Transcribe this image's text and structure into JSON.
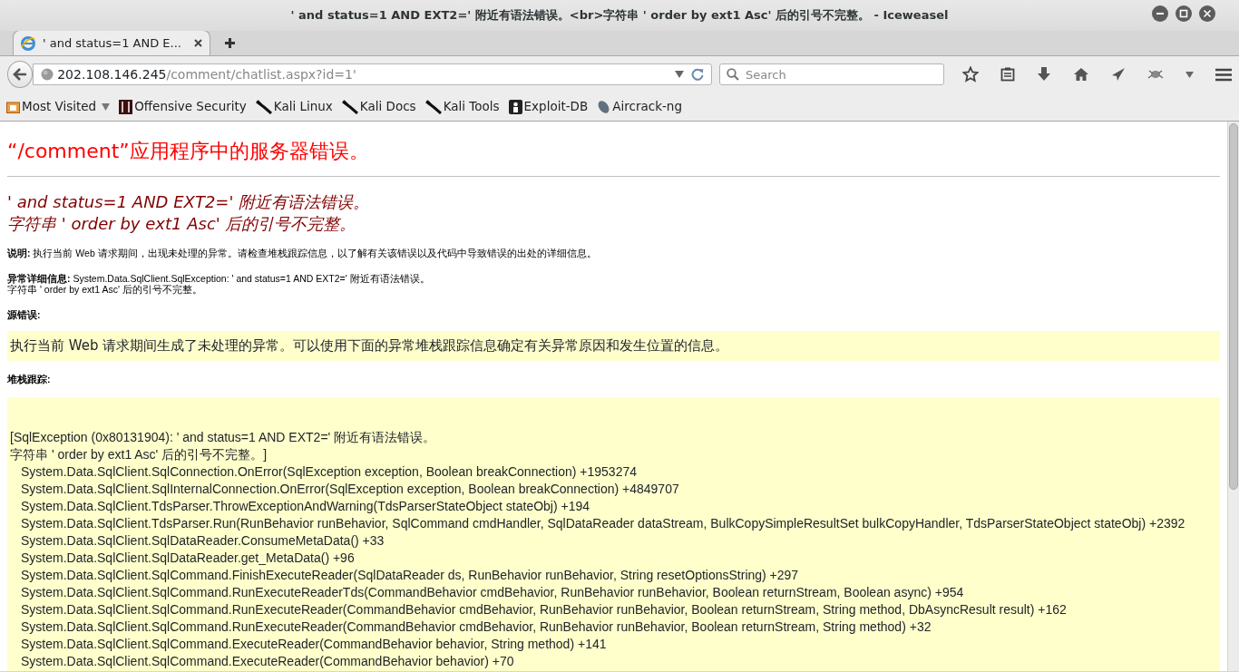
{
  "window": {
    "title": "' and status=1 AND EXT2=' 附近有语法错误。<br>字符串 ' order by ext1 Asc' 后的引号不完整。 - Iceweasel"
  },
  "tabs": [
    {
      "label": "' and status=1 AND E...",
      "selected": true
    }
  ],
  "address_bar": {
    "host": "202.108.146.245",
    "path": "/comment/chatlist.aspx?id=1'"
  },
  "search": {
    "placeholder": "Search"
  },
  "bookmarks": [
    {
      "label": "Most Visited",
      "dropdown": true
    },
    {
      "label": "Offensive Security",
      "dropdown": false
    },
    {
      "label": "Kali Linux",
      "dropdown": false
    },
    {
      "label": "Kali Docs",
      "dropdown": false
    },
    {
      "label": "Kali Tools",
      "dropdown": false
    },
    {
      "label": "Exploit-DB",
      "dropdown": false
    },
    {
      "label": "Aircrack-ng",
      "dropdown": false
    }
  ],
  "page": {
    "heading": "“/comment”应用程序中的服务器错误。",
    "error_message": [
      "' and status=1 AND EXT2=' 附近有语法错误。",
      "字符串 ' order by ext1 Asc' 后的引号不完整。"
    ],
    "description": {
      "label": "说明:",
      "text": "执行当前 Web 请求期间，出现未处理的异常。请检查堆栈跟踪信息，以了解有关该错误以及代码中导致错误的出处的详细信息。"
    },
    "exception_details": {
      "label": "异常详细信息:",
      "lines": [
        "System.Data.SqlClient.SqlException: ' and status=1 AND EXT2=' 附近有语法错误。",
        "字符串 ' order by ext1 Asc' 后的引号不完整。"
      ]
    },
    "source_error": {
      "label": "源错误:",
      "text": "执行当前 Web 请求期间生成了未处理的异常。可以使用下面的异常堆栈跟踪信息确定有关异常原因和发生位置的信息。"
    },
    "stack_trace": {
      "label": "堆栈跟踪:",
      "lines": [
        {
          "kind": "message",
          "text": "[SqlException (0x80131904): ' and status=1 AND EXT2=' 附近有语法错误。"
        },
        {
          "kind": "message",
          "text": "字符串 ' order by ext1 Asc' 后的引号不完整。]"
        },
        {
          "kind": "frame",
          "text": "System.Data.SqlClient.SqlConnection.OnError(SqlException exception, Boolean breakConnection) +1953274"
        },
        {
          "kind": "frame",
          "text": "System.Data.SqlClient.SqlInternalConnection.OnError(SqlException exception, Boolean breakConnection) +4849707"
        },
        {
          "kind": "frame",
          "text": "System.Data.SqlClient.TdsParser.ThrowExceptionAndWarning(TdsParserStateObject stateObj) +194"
        },
        {
          "kind": "frame",
          "text": "System.Data.SqlClient.TdsParser.Run(RunBehavior runBehavior, SqlCommand cmdHandler, SqlDataReader dataStream, BulkCopySimpleResultSet bulkCopyHandler, TdsParserStateObject stateObj) +2392"
        },
        {
          "kind": "frame",
          "text": "System.Data.SqlClient.SqlDataReader.ConsumeMetaData() +33"
        },
        {
          "kind": "frame",
          "text": "System.Data.SqlClient.SqlDataReader.get_MetaData() +96"
        },
        {
          "kind": "frame",
          "text": "System.Data.SqlClient.SqlCommand.FinishExecuteReader(SqlDataReader ds, RunBehavior runBehavior, String resetOptionsString) +297"
        },
        {
          "kind": "frame",
          "text": "System.Data.SqlClient.SqlCommand.RunExecuteReaderTds(CommandBehavior cmdBehavior, RunBehavior runBehavior, Boolean returnStream, Boolean async) +954"
        },
        {
          "kind": "frame",
          "text": "System.Data.SqlClient.SqlCommand.RunExecuteReader(CommandBehavior cmdBehavior, RunBehavior runBehavior, Boolean returnStream, String method, DbAsyncResult result) +162"
        },
        {
          "kind": "frame",
          "text": "System.Data.SqlClient.SqlCommand.RunExecuteReader(CommandBehavior cmdBehavior, RunBehavior runBehavior, Boolean returnStream, String method) +32"
        },
        {
          "kind": "frame",
          "text": "System.Data.SqlClient.SqlCommand.ExecuteReader(CommandBehavior behavior, String method) +141"
        },
        {
          "kind": "frame",
          "text": "System.Data.SqlClient.SqlCommand.ExecuteReader(CommandBehavior behavior) +70"
        }
      ]
    }
  }
}
